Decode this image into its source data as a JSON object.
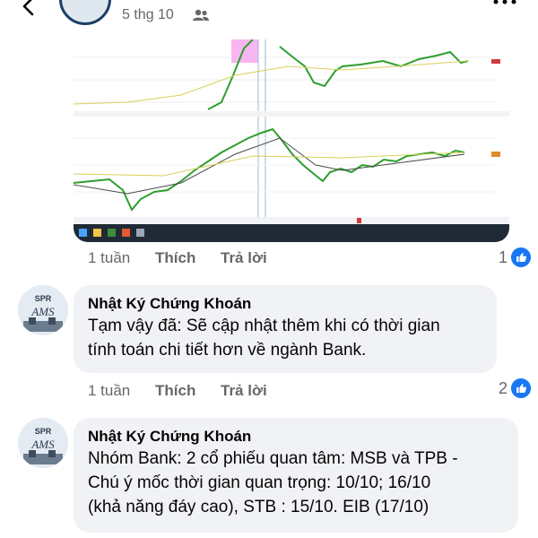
{
  "header": {
    "date": "5 thg 10",
    "back_icon": "chevron-left-icon",
    "audience_icon": "friends-icon",
    "more_icon": "more-horizontal-icon"
  },
  "chart_screenshot": {
    "description_icon": "embedded-stock-chart-image"
  },
  "reply_0": {
    "time": "1 tuần",
    "like_label": "Thích",
    "reply_label": "Trả lời",
    "reaction_count": "1"
  },
  "comments": [
    {
      "author": "Nhật Ký Chứng Khoán",
      "avatar_text_top": "SPR",
      "avatar_text_bottom": "AMS",
      "lines": [
        "Tạm vậy đã: Sẽ cập nhật thêm khi có thời gian",
        "tính toán chi tiết hơn về ngành Bank."
      ],
      "time": "1 tuần",
      "like_label": "Thích",
      "reply_label": "Trả lời",
      "reaction_count": "2"
    },
    {
      "author": "Nhật Ký Chứng Khoán",
      "avatar_text_top": "SPR",
      "avatar_text_bottom": "AMS",
      "lines": [
        "Nhóm Bank: 2 cổ phiếu quan tâm: MSB và TPB -",
        "Chú ý mốc thời gian quan trọng: 10/10; 16/10",
        "(khả năng đáy cao), STB : 15/10. EIB (17/10)"
      ]
    }
  ],
  "colors": {
    "bubble": "#f0f2f5",
    "secondary_text": "#65676b",
    "like_blue": "#1877f2",
    "candle_up": "#2e9e2e",
    "candle_down": "#1a1a1a",
    "highlight": "#f7b6f0",
    "taskbar": "#1f2a36"
  }
}
